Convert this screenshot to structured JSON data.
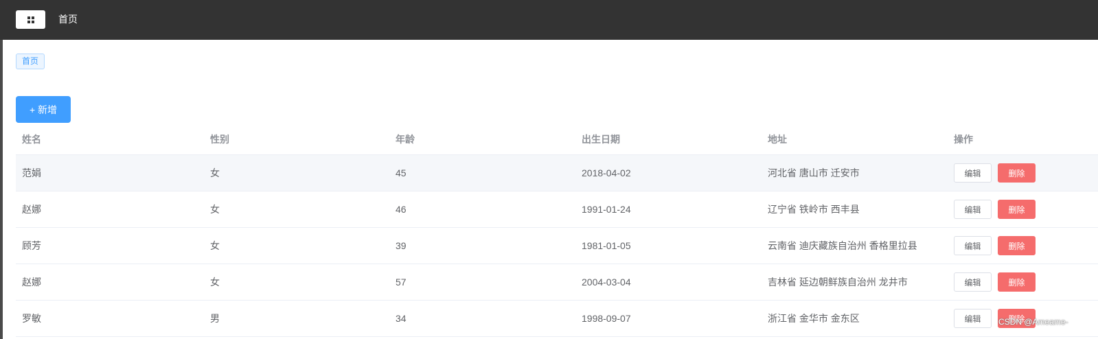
{
  "header": {
    "menu_icon": "grid-icon",
    "title": "首页"
  },
  "tags": [
    {
      "label": "首页"
    }
  ],
  "toolbar": {
    "add_label": "+ 新增"
  },
  "table": {
    "columns": [
      "姓名",
      "性别",
      "年龄",
      "出生日期",
      "地址",
      "操作"
    ],
    "rows": [
      {
        "name": "范娟",
        "gender": "女",
        "age": "45",
        "birth": "2018-04-02",
        "address": "河北省 唐山市 迁安市"
      },
      {
        "name": "赵娜",
        "gender": "女",
        "age": "46",
        "birth": "1991-01-24",
        "address": "辽宁省 铁岭市 西丰县"
      },
      {
        "name": "顾芳",
        "gender": "女",
        "age": "39",
        "birth": "1981-01-05",
        "address": "云南省 迪庆藏族自治州 香格里拉县"
      },
      {
        "name": "赵娜",
        "gender": "女",
        "age": "57",
        "birth": "2004-03-04",
        "address": "吉林省 延边朝鲜族自治州 龙井市"
      },
      {
        "name": "罗敏",
        "gender": "男",
        "age": "34",
        "birth": "1998-09-07",
        "address": "浙江省 金华市 金东区"
      }
    ],
    "edit_label": "编辑",
    "delete_label": "删除"
  },
  "colors": {
    "header_bg": "#333333",
    "primary": "#409eff",
    "danger": "#f56c6c",
    "stripe": "#f5f7fa"
  },
  "watermark": "CSDN @Ameame-"
}
